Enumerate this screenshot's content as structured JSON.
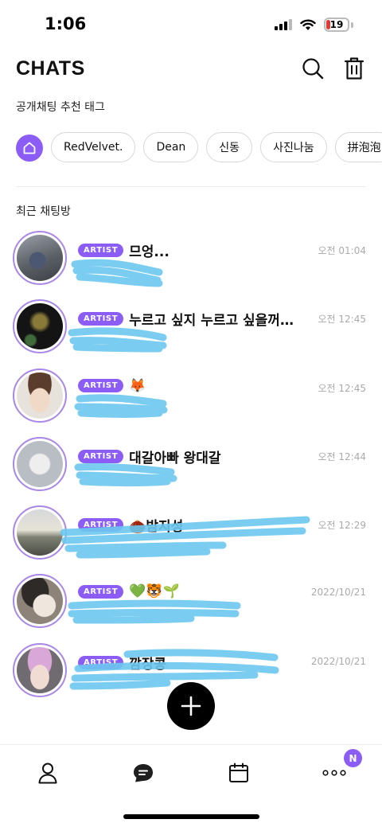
{
  "status_bar": {
    "time": "1:06",
    "battery": "19"
  },
  "header": {
    "title": "CHATS"
  },
  "recommended_tags": {
    "label": "공개채팅 추천 태그",
    "tags": [
      "RedVelvet.",
      "Dean",
      "신동",
      "사진나눔",
      "拼泡泡"
    ]
  },
  "recent": {
    "label": "최근 채팅방",
    "chats": [
      {
        "badge": "ARTIST",
        "name": "므엉...",
        "time": "오전 01:04"
      },
      {
        "badge": "ARTIST",
        "name": "누르고 싶지 누르고 싶을꺼야...",
        "time": "오전 12:45"
      },
      {
        "badge": "ARTIST",
        "name": "🦊",
        "time": "오전 12:45"
      },
      {
        "badge": "ARTIST",
        "name": "대갈아빠 왕대갈",
        "time": "오전 12:44"
      },
      {
        "badge": "ARTIST",
        "name": "🌰밤지성",
        "time": "오전 12:29"
      },
      {
        "badge": "ARTIST",
        "name": "💚🐯🌱",
        "time": "2022/10/21"
      },
      {
        "badge": "ARTIST",
        "name": "깜장콩",
        "time": "2022/10/21"
      }
    ]
  },
  "bottom_nav": {
    "more_badge": "N"
  },
  "colors": {
    "accent": "#8b5cf6",
    "scribble": "#6cc6ef"
  }
}
